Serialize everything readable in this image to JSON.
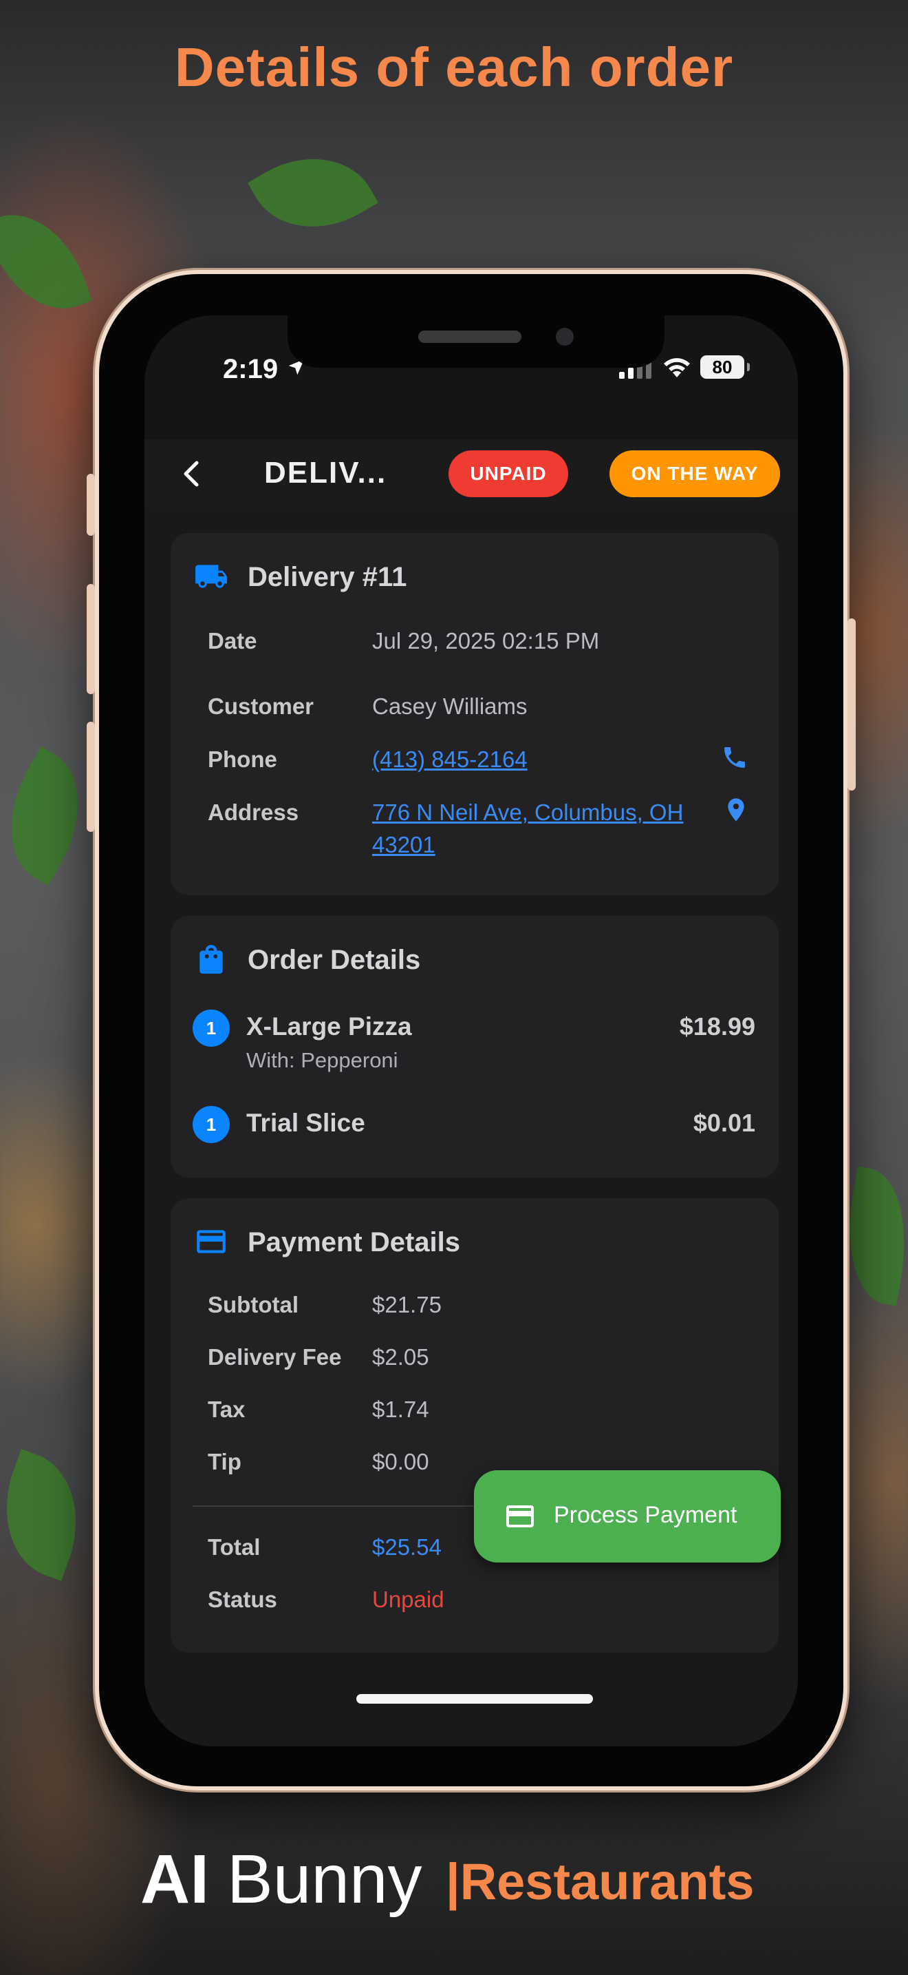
{
  "headline": "Details of each order",
  "status_bar": {
    "time": "2:19",
    "battery": "80"
  },
  "header": {
    "title": "DELIV...",
    "badges": {
      "payment": "UNPAID",
      "delivery": "ON THE WAY"
    }
  },
  "delivery_card": {
    "title": "Delivery #11",
    "rows": [
      {
        "label": "Date",
        "value": "Jul 29, 2025 02:15 PM"
      },
      {
        "label": "Customer",
        "value": "Casey Williams"
      },
      {
        "label": "Phone",
        "value": "(413) 845-2164"
      },
      {
        "label": "Address",
        "value_line1": "776 N Neil Ave, Columbus, OH",
        "value_line2": "43201"
      }
    ]
  },
  "order_card": {
    "title": "Order Details",
    "items": [
      {
        "qty": "1",
        "name": "X-Large Pizza",
        "modifier": "With: Pepperoni",
        "price": "$18.99"
      },
      {
        "qty": "1",
        "name": "Trial Slice",
        "price": "$0.01"
      }
    ]
  },
  "payment_card": {
    "title": "Payment Details",
    "rows": [
      {
        "label": "Subtotal",
        "value": "$21.75"
      },
      {
        "label": "Delivery Fee",
        "value": "$2.05"
      },
      {
        "label": "Tax",
        "value": "$1.74"
      },
      {
        "label": "Tip",
        "value": "$0.00"
      }
    ],
    "total": {
      "label": "Total",
      "value": "$25.54"
    },
    "status": {
      "label": "Status",
      "value": "Unpaid"
    }
  },
  "fab": {
    "label": "Process Payment"
  },
  "brand": {
    "ai": "AI",
    "bunny": "Bunny",
    "restaurants": "|Restaurants"
  },
  "colors": {
    "accent_orange": "#F5884A",
    "unpaid_red": "#EF3B32",
    "on_the_way_orange": "#FF9500",
    "link_blue": "#3B8BF5",
    "process_green": "#4CAF50",
    "card_bg": "#222224"
  }
}
